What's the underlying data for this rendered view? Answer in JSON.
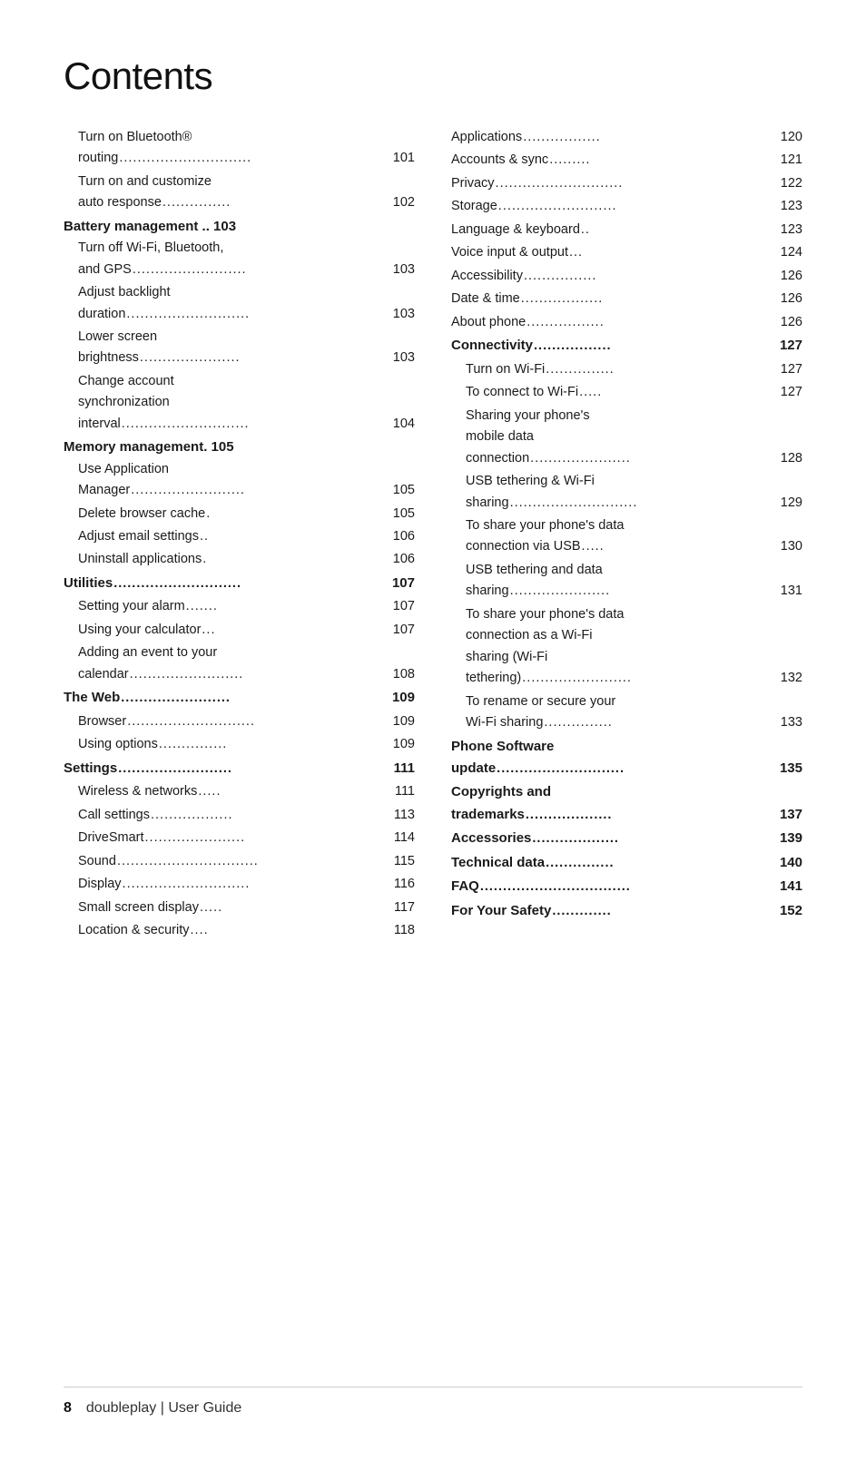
{
  "title": "Contents",
  "left_column": [
    {
      "text": "Turn on Bluetooth®",
      "leader": "",
      "page": "",
      "bold": false,
      "indent": true
    },
    {
      "text": "routing",
      "leader": ".............................",
      "page": "101",
      "bold": false,
      "indent": true
    },
    {
      "text": "Turn on and customize",
      "leader": "",
      "page": "",
      "bold": false,
      "indent": true
    },
    {
      "text": "auto response",
      "leader": "...............",
      "page": "102",
      "bold": false,
      "indent": true
    },
    {
      "text": "Battery management .. 103",
      "leader": "",
      "page": "",
      "bold": true,
      "indent": false
    },
    {
      "text": "Turn off Wi-Fi, Bluetooth,",
      "leader": "",
      "page": "",
      "bold": false,
      "indent": true
    },
    {
      "text": "and GPS",
      "leader": ".........................",
      "page": "103",
      "bold": false,
      "indent": true
    },
    {
      "text": "Adjust backlight",
      "leader": "",
      "page": "",
      "bold": false,
      "indent": true
    },
    {
      "text": "duration",
      "leader": "...........................",
      "page": "103",
      "bold": false,
      "indent": true
    },
    {
      "text": "Lower screen",
      "leader": "",
      "page": "",
      "bold": false,
      "indent": true
    },
    {
      "text": "brightness",
      "leader": "......................",
      "page": "103",
      "bold": false,
      "indent": true
    },
    {
      "text": "Change account",
      "leader": "",
      "page": "",
      "bold": false,
      "indent": true
    },
    {
      "text": "synchronization",
      "leader": "",
      "page": "",
      "bold": false,
      "indent": true
    },
    {
      "text": "interval",
      "leader": "............................",
      "page": "104",
      "bold": false,
      "indent": true
    },
    {
      "text": "Memory management. 105",
      "leader": "",
      "page": "",
      "bold": true,
      "indent": false
    },
    {
      "text": "Use Application",
      "leader": "",
      "page": "",
      "bold": false,
      "indent": true
    },
    {
      "text": "Manager",
      "leader": ".........................",
      "page": "105",
      "bold": false,
      "indent": true
    },
    {
      "text": "Delete browser cache",
      "leader": ".",
      "page": "105",
      "bold": false,
      "indent": true
    },
    {
      "text": "Adjust email settings",
      "leader": "..",
      "page": "106",
      "bold": false,
      "indent": true
    },
    {
      "text": "Uninstall applications",
      "leader": " .",
      "page": "106",
      "bold": false,
      "indent": true
    },
    {
      "text": "Utilities",
      "leader": "............................",
      "page": "107",
      "bold": true,
      "indent": false
    },
    {
      "text": "Setting your alarm",
      "leader": ".......",
      "page": "107",
      "bold": false,
      "indent": true
    },
    {
      "text": "Using your calculator",
      "leader": "...",
      "page": "107",
      "bold": false,
      "indent": true
    },
    {
      "text": "Adding an event to your",
      "leader": "",
      "page": "",
      "bold": false,
      "indent": true
    },
    {
      "text": "calendar",
      "leader": ".........................",
      "page": "108",
      "bold": false,
      "indent": true
    },
    {
      "text": "The Web",
      "leader": "........................",
      "page": "109",
      "bold": true,
      "indent": false
    },
    {
      "text": "Browser",
      "leader": "............................",
      "page": "109",
      "bold": false,
      "indent": true
    },
    {
      "text": "Using options",
      "leader": "...............",
      "page": "109",
      "bold": false,
      "indent": true
    },
    {
      "text": "Settings",
      "leader": " .........................",
      "page": "111",
      "bold": true,
      "indent": false
    },
    {
      "text": "Wireless & networks",
      "leader": ".....",
      "page": "111",
      "bold": false,
      "indent": true
    },
    {
      "text": "Call settings",
      "leader": "..................",
      "page": "113",
      "bold": false,
      "indent": true
    },
    {
      "text": "DriveSmart",
      "leader": "......................",
      "page": "114",
      "bold": false,
      "indent": true
    },
    {
      "text": "Sound",
      "leader": "...............................",
      "page": "115",
      "bold": false,
      "indent": true
    },
    {
      "text": "Display",
      "leader": " ............................",
      "page": "116",
      "bold": false,
      "indent": true
    },
    {
      "text": "Small screen display",
      "leader": ".....",
      "page": "117",
      "bold": false,
      "indent": true
    },
    {
      "text": "Location & security",
      "leader": " ....",
      "page": "118",
      "bold": false,
      "indent": true
    }
  ],
  "right_column": [
    {
      "text": "Applications",
      "leader": ".................",
      "page": "120",
      "bold": false,
      "indent": false
    },
    {
      "text": "Accounts & sync",
      "leader": " .........",
      "page": "121",
      "bold": false,
      "indent": false
    },
    {
      "text": "Privacy",
      "leader": "............................",
      "page": "122",
      "bold": false,
      "indent": false
    },
    {
      "text": "Storage",
      "leader": " ..........................",
      "page": "123",
      "bold": false,
      "indent": false
    },
    {
      "text": "Language & keyboard",
      "leader": "..",
      "page": "123",
      "bold": false,
      "indent": false
    },
    {
      "text": "Voice input & output",
      "leader": "...",
      "page": "124",
      "bold": false,
      "indent": false
    },
    {
      "text": "Accessibility",
      "leader": "................",
      "page": "126",
      "bold": false,
      "indent": false
    },
    {
      "text": "Date & time",
      "leader": " ..................",
      "page": "126",
      "bold": false,
      "indent": false
    },
    {
      "text": "About phone",
      "leader": ".................",
      "page": "126",
      "bold": false,
      "indent": false
    },
    {
      "text": "Connectivity",
      "leader": ".................",
      "page": "127",
      "bold": true,
      "indent": false
    },
    {
      "text": "Turn on Wi-Fi",
      "leader": "...............",
      "page": "127",
      "bold": false,
      "indent": true
    },
    {
      "text": "To connect to Wi-Fi",
      "leader": ".....",
      "page": "127",
      "bold": false,
      "indent": true
    },
    {
      "text": "Sharing your phone's",
      "leader": "",
      "page": "",
      "bold": false,
      "indent": true
    },
    {
      "text": "mobile data",
      "leader": "",
      "page": "",
      "bold": false,
      "indent": true
    },
    {
      "text": "connection",
      "leader": "......................",
      "page": "128",
      "bold": false,
      "indent": true
    },
    {
      "text": "USB tethering & Wi-Fi",
      "leader": "",
      "page": "",
      "bold": false,
      "indent": true
    },
    {
      "text": "sharing",
      "leader": "............................",
      "page": "129",
      "bold": false,
      "indent": true
    },
    {
      "text": "To share your phone's data",
      "leader": "",
      "page": "",
      "bold": false,
      "indent": true
    },
    {
      "text": "connection via USB",
      "leader": ".....",
      "page": "130",
      "bold": false,
      "indent": true
    },
    {
      "text": "USB tethering and data",
      "leader": "",
      "page": "",
      "bold": false,
      "indent": true
    },
    {
      "text": "sharing",
      "leader": " ......................",
      "page": "131",
      "bold": false,
      "indent": true
    },
    {
      "text": "To share your phone's data",
      "leader": "",
      "page": "",
      "bold": false,
      "indent": true
    },
    {
      "text": "connection as a Wi-Fi",
      "leader": "",
      "page": "",
      "bold": false,
      "indent": true
    },
    {
      "text": "sharing (Wi-Fi",
      "leader": "",
      "page": "",
      "bold": false,
      "indent": true
    },
    {
      "text": "tethering)",
      "leader": "........................",
      "page": "132",
      "bold": false,
      "indent": true
    },
    {
      "text": "To rename or secure your",
      "leader": "",
      "page": "",
      "bold": false,
      "indent": true
    },
    {
      "text": "Wi-Fi sharing",
      "leader": "...............",
      "page": "133",
      "bold": false,
      "indent": true
    },
    {
      "text": "Phone Software",
      "leader": "",
      "page": "",
      "bold": true,
      "indent": false
    },
    {
      "text": "update",
      "leader": "............................",
      "page": "135",
      "bold": true,
      "indent": false
    },
    {
      "text": "Copyrights and",
      "leader": "",
      "page": "",
      "bold": true,
      "indent": false
    },
    {
      "text": "trademarks",
      "leader": "...................",
      "page": "137",
      "bold": true,
      "indent": false
    },
    {
      "text": "Accessories",
      "leader": "...................",
      "page": "139",
      "bold": true,
      "indent": false
    },
    {
      "text": "Technical data",
      "leader": " ...............",
      "page": "140",
      "bold": true,
      "indent": false
    },
    {
      "text": "FAQ",
      "leader": ".................................",
      "page": "141",
      "bold": true,
      "indent": false
    },
    {
      "text": "For Your Safety",
      "leader": ".............",
      "page": "152",
      "bold": true,
      "indent": false
    }
  ],
  "footer": {
    "page_number": "8",
    "divider": "|",
    "title": "doubleplay  |  User Guide"
  }
}
